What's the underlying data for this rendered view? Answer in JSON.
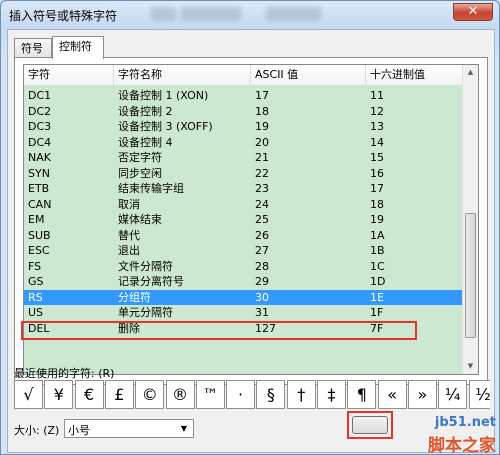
{
  "window": {
    "title": "插入符号或特殊字符",
    "close_glyph": "✕"
  },
  "tabs": [
    {
      "label": "符号"
    },
    {
      "label": "控制符"
    }
  ],
  "table": {
    "headers": [
      "字符",
      "字符名称",
      "ASCII 值",
      "十六进制值"
    ],
    "rows": [
      [
        "DC1",
        "设备控制 1 (XON)",
        "17",
        "11"
      ],
      [
        "DC2",
        "设备控制 2",
        "18",
        "12"
      ],
      [
        "DC3",
        "设备控制 3 (XOFF)",
        "19",
        "13"
      ],
      [
        "DC4",
        "设备控制 4",
        "20",
        "14"
      ],
      [
        "NAK",
        "否定字符",
        "21",
        "15"
      ],
      [
        "SYN",
        "同步空闲",
        "22",
        "16"
      ],
      [
        "ETB",
        "结束传输字组",
        "23",
        "17"
      ],
      [
        "CAN",
        "取消",
        "24",
        "18"
      ],
      [
        "EM",
        "媒体结束",
        "25",
        "19"
      ],
      [
        "SUB",
        "替代",
        "26",
        "1A"
      ],
      [
        "ESC",
        "退出",
        "27",
        "1B"
      ],
      [
        "FS",
        "文件分隔符",
        "28",
        "1C"
      ],
      [
        "GS",
        "记录分离符号",
        "29",
        "1D"
      ],
      [
        "RS",
        "分组符",
        "30",
        "1E"
      ],
      [
        "US",
        "单元分隔符",
        "31",
        "1F"
      ],
      [
        "DEL",
        "删除",
        "127",
        "7F"
      ]
    ],
    "selected_row_index": 13
  },
  "recent": {
    "label": "最近使用的字符:",
    "shortcut": "(R)",
    "symbols": [
      "√",
      "¥",
      "€",
      "£",
      "©",
      "®",
      "™",
      "·",
      "§",
      "†",
      "‡",
      "¶",
      "«",
      "»",
      "¼",
      "½"
    ]
  },
  "size": {
    "label": "大小:",
    "shortcut": "(Z)",
    "value": "小号"
  },
  "watermark": {
    "line1": "jb51.net",
    "line2": "脚本之家"
  },
  "colors": {
    "list_background": "#cde8d0",
    "selection": "#3399ff",
    "highlight": "#e8322e"
  }
}
